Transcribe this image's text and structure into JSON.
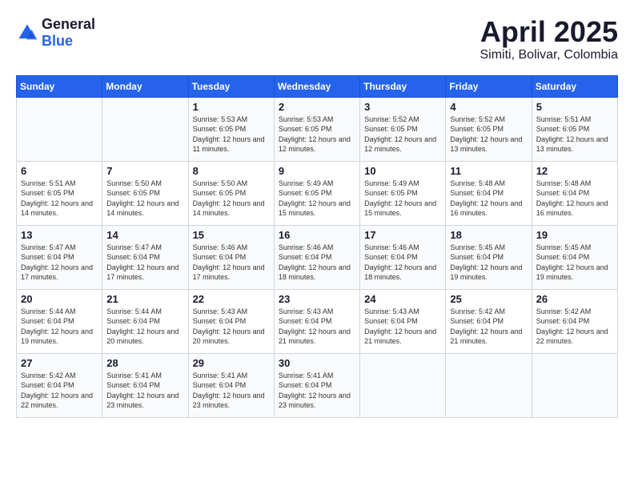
{
  "header": {
    "logo_general": "General",
    "logo_blue": "Blue",
    "title": "April 2025",
    "subtitle": "Simiti, Bolivar, Colombia"
  },
  "calendar": {
    "days_of_week": [
      "Sunday",
      "Monday",
      "Tuesday",
      "Wednesday",
      "Thursday",
      "Friday",
      "Saturday"
    ],
    "weeks": [
      [
        {
          "day": "",
          "info": ""
        },
        {
          "day": "",
          "info": ""
        },
        {
          "day": "1",
          "info": "Sunrise: 5:53 AM\nSunset: 6:05 PM\nDaylight: 12 hours and 11 minutes."
        },
        {
          "day": "2",
          "info": "Sunrise: 5:53 AM\nSunset: 6:05 PM\nDaylight: 12 hours and 12 minutes."
        },
        {
          "day": "3",
          "info": "Sunrise: 5:52 AM\nSunset: 6:05 PM\nDaylight: 12 hours and 12 minutes."
        },
        {
          "day": "4",
          "info": "Sunrise: 5:52 AM\nSunset: 6:05 PM\nDaylight: 12 hours and 13 minutes."
        },
        {
          "day": "5",
          "info": "Sunrise: 5:51 AM\nSunset: 6:05 PM\nDaylight: 12 hours and 13 minutes."
        }
      ],
      [
        {
          "day": "6",
          "info": "Sunrise: 5:51 AM\nSunset: 6:05 PM\nDaylight: 12 hours and 14 minutes."
        },
        {
          "day": "7",
          "info": "Sunrise: 5:50 AM\nSunset: 6:05 PM\nDaylight: 12 hours and 14 minutes."
        },
        {
          "day": "8",
          "info": "Sunrise: 5:50 AM\nSunset: 6:05 PM\nDaylight: 12 hours and 14 minutes."
        },
        {
          "day": "9",
          "info": "Sunrise: 5:49 AM\nSunset: 6:05 PM\nDaylight: 12 hours and 15 minutes."
        },
        {
          "day": "10",
          "info": "Sunrise: 5:49 AM\nSunset: 6:05 PM\nDaylight: 12 hours and 15 minutes."
        },
        {
          "day": "11",
          "info": "Sunrise: 5:48 AM\nSunset: 6:04 PM\nDaylight: 12 hours and 16 minutes."
        },
        {
          "day": "12",
          "info": "Sunrise: 5:48 AM\nSunset: 6:04 PM\nDaylight: 12 hours and 16 minutes."
        }
      ],
      [
        {
          "day": "13",
          "info": "Sunrise: 5:47 AM\nSunset: 6:04 PM\nDaylight: 12 hours and 17 minutes."
        },
        {
          "day": "14",
          "info": "Sunrise: 5:47 AM\nSunset: 6:04 PM\nDaylight: 12 hours and 17 minutes."
        },
        {
          "day": "15",
          "info": "Sunrise: 5:46 AM\nSunset: 6:04 PM\nDaylight: 12 hours and 17 minutes."
        },
        {
          "day": "16",
          "info": "Sunrise: 5:46 AM\nSunset: 6:04 PM\nDaylight: 12 hours and 18 minutes."
        },
        {
          "day": "17",
          "info": "Sunrise: 5:46 AM\nSunset: 6:04 PM\nDaylight: 12 hours and 18 minutes."
        },
        {
          "day": "18",
          "info": "Sunrise: 5:45 AM\nSunset: 6:04 PM\nDaylight: 12 hours and 19 minutes."
        },
        {
          "day": "19",
          "info": "Sunrise: 5:45 AM\nSunset: 6:04 PM\nDaylight: 12 hours and 19 minutes."
        }
      ],
      [
        {
          "day": "20",
          "info": "Sunrise: 5:44 AM\nSunset: 6:04 PM\nDaylight: 12 hours and 19 minutes."
        },
        {
          "day": "21",
          "info": "Sunrise: 5:44 AM\nSunset: 6:04 PM\nDaylight: 12 hours and 20 minutes."
        },
        {
          "day": "22",
          "info": "Sunrise: 5:43 AM\nSunset: 6:04 PM\nDaylight: 12 hours and 20 minutes."
        },
        {
          "day": "23",
          "info": "Sunrise: 5:43 AM\nSunset: 6:04 PM\nDaylight: 12 hours and 21 minutes."
        },
        {
          "day": "24",
          "info": "Sunrise: 5:43 AM\nSunset: 6:04 PM\nDaylight: 12 hours and 21 minutes."
        },
        {
          "day": "25",
          "info": "Sunrise: 5:42 AM\nSunset: 6:04 PM\nDaylight: 12 hours and 21 minutes."
        },
        {
          "day": "26",
          "info": "Sunrise: 5:42 AM\nSunset: 6:04 PM\nDaylight: 12 hours and 22 minutes."
        }
      ],
      [
        {
          "day": "27",
          "info": "Sunrise: 5:42 AM\nSunset: 6:04 PM\nDaylight: 12 hours and 22 minutes."
        },
        {
          "day": "28",
          "info": "Sunrise: 5:41 AM\nSunset: 6:04 PM\nDaylight: 12 hours and 23 minutes."
        },
        {
          "day": "29",
          "info": "Sunrise: 5:41 AM\nSunset: 6:04 PM\nDaylight: 12 hours and 23 minutes."
        },
        {
          "day": "30",
          "info": "Sunrise: 5:41 AM\nSunset: 6:04 PM\nDaylight: 12 hours and 23 minutes."
        },
        {
          "day": "",
          "info": ""
        },
        {
          "day": "",
          "info": ""
        },
        {
          "day": "",
          "info": ""
        }
      ]
    ]
  }
}
